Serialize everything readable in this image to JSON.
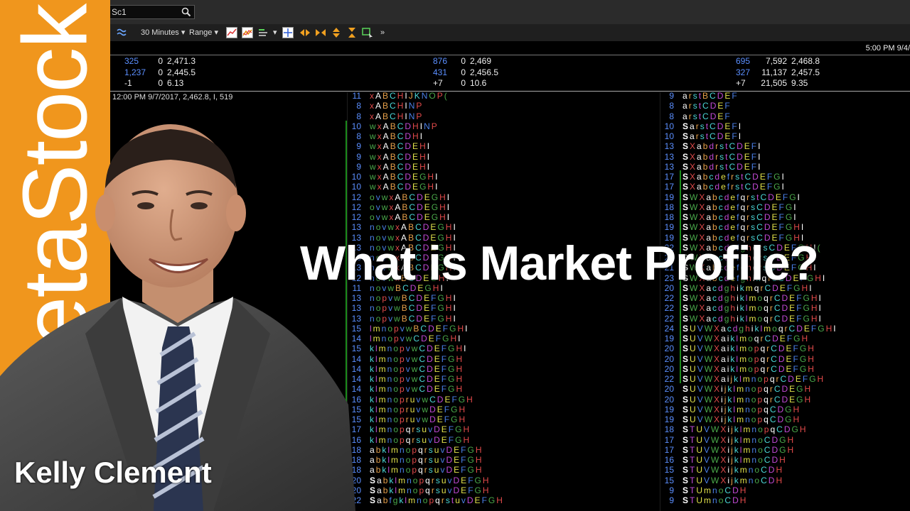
{
  "search": {
    "symbol": "Sc1"
  },
  "toolbar": {
    "interval": "30 Minutes",
    "range": "Range"
  },
  "status": {
    "datetime": "5:00 PM 9/4/"
  },
  "quotes": [
    {
      "rows": [
        [
          "325",
          "0",
          "2,471.3"
        ],
        [
          "1,237",
          "0",
          "2,445.5"
        ],
        [
          "-1",
          "0",
          "6.13"
        ]
      ]
    },
    {
      "rows": [
        [
          "876",
          "0",
          "2,469"
        ],
        [
          "431",
          "0",
          "2,456.5"
        ],
        [
          "+7",
          "0",
          "10.6"
        ]
      ]
    },
    {
      "rows": [
        [
          "695",
          "7,592",
          "2,468.8"
        ],
        [
          "327",
          "11,137",
          "2,457.5"
        ],
        [
          "+7",
          "21,505",
          "9.35"
        ]
      ]
    }
  ],
  "chart_info": "12:00 PM 9/7/2017, 2,462.8, I, 519",
  "profile_left": [
    [
      "11",
      "xABCHIJKNOP("
    ],
    [
      "8",
      "xABCHINP"
    ],
    [
      "8",
      "xABCHINP"
    ],
    [
      "10",
      "wxABCDHINP"
    ],
    [
      "8",
      "wxABCDHI"
    ],
    [
      "9",
      "wxABCDEHI"
    ],
    [
      "9",
      "wxABCDEHI"
    ],
    [
      "9",
      "wxABCDEHI"
    ],
    [
      "10",
      "wxABCDEGHI"
    ],
    [
      "10",
      "wxABCDEGHI"
    ],
    [
      "12",
      "ovwxABCDEGHI"
    ],
    [
      "12",
      "ovwxABCDEGHI"
    ],
    [
      "12",
      "ovwxABCDEGHI"
    ],
    [
      "13",
      "novwxABCDEGHI"
    ],
    [
      "13",
      "novwxABCDEGHI"
    ],
    [
      "13",
      "novwxABCDEGHI"
    ],
    [
      "13",
      "novwxABCDEGHI"
    ],
    [
      "13",
      "novwxABCDEGHI"
    ],
    [
      "12",
      "novwxBCDEGHI"
    ],
    [
      "11",
      "novwBCDEGHI"
    ],
    [
      "13",
      "nopvwBCDEFGHI"
    ],
    [
      "13",
      "nopvwBCDEFGHI"
    ],
    [
      "13",
      "nopvwBCDEFGHI"
    ],
    [
      "15",
      "lmnopvwBCDEFGHI"
    ],
    [
      "14",
      "lmnopvwCDEFGHI"
    ],
    [
      "15",
      "klmnopvwCDEFGHI"
    ],
    [
      "14",
      "klmnopvwCDEFGH"
    ],
    [
      "14",
      "klmnopvwCDEFGH"
    ],
    [
      "14",
      "klmnopvwCDEFGH"
    ],
    [
      "14",
      "klmnopvwCDEFGH"
    ],
    [
      "16",
      "klmnopruvwCDEFGH"
    ],
    [
      "15",
      "klmnopruvwDEFGH"
    ],
    [
      "15",
      "klmnopruvwDEFGH"
    ],
    [
      "17",
      "klmnopqrsuvDEFGH"
    ],
    [
      "16",
      "klmnopqrsuvDEFGH"
    ],
    [
      "18",
      "abklmnopqrsuvDEFGH"
    ],
    [
      "18",
      "abklmnopqrsuvDEFGH"
    ],
    [
      "18",
      "abklmnopqrsuvDEFGH"
    ],
    [
      "20",
      "SabklmnopqrsuvDEFGH"
    ],
    [
      "20",
      "SabklmnopqrsuvDEFGH"
    ],
    [
      "22",
      "SabfgklmnopqrstuvDEFGH"
    ]
  ],
  "profile_right": [
    [
      "9",
      "arstBCDEF"
    ],
    [
      "8",
      "arstCDEF"
    ],
    [
      "8",
      "arstCDEF"
    ],
    [
      "10",
      "SarstCDEFI"
    ],
    [
      "10",
      "SarstCDEFI"
    ],
    [
      "13",
      "SXabdrstCDEFI"
    ],
    [
      "13",
      "SXabdrstCDEFI"
    ],
    [
      "13",
      "SXabdrstCDEFI"
    ],
    [
      "17",
      "SXabcdefrstCDEFGI"
    ],
    [
      "17",
      "SXabcdefrstCDEFGI"
    ],
    [
      "19",
      "SWXabcdefqrstCDEFGI"
    ],
    [
      "18",
      "SWXabcdefqrsCDEFGI"
    ],
    [
      "18",
      "SWXabcdefqrsCDEFGI"
    ],
    [
      "19",
      "SWXabcdefqrsCDEFGHI"
    ],
    [
      "19",
      "SWXabcdefqrsCDEFGHI"
    ],
    [
      "22",
      "SWXabcdefghqrsCDEFGHI("
    ],
    [
      "21",
      "SWXabcdefghqrsCDEFGHI"
    ],
    [
      "21",
      "SWXabcdefghqrsCDEFGHI"
    ],
    [
      "23",
      "SWXabcdefghikqrsCDEFGHI"
    ],
    [
      "20",
      "SWXacdghikmqrCDEFGHI"
    ],
    [
      "22",
      "SWXacdghiklmoqrCDEFGHI"
    ],
    [
      "22",
      "SWXacdghiklmoqrCDEFGHI"
    ],
    [
      "22",
      "SWXacdghiklmoqrCDEFGHI"
    ],
    [
      "24",
      "SUVWXacdghiklmoqrCDEFGHI"
    ],
    [
      "19",
      "SUVWXaiklmoqrCDEFGH"
    ],
    [
      "20",
      "SUVWXaiklmopqrCDEFGH"
    ],
    [
      "20",
      "SUVWXaiklmopqrCDEFGH"
    ],
    [
      "20",
      "SUVWXaiklmopqrCDEFGH"
    ],
    [
      "22",
      "SUVWXaijklmnopqrCDEFGH"
    ],
    [
      "20",
      "SUVWXijklmnopqrCDEGH"
    ],
    [
      "20",
      "SUVWXijklmnopqrCDEGH"
    ],
    [
      "19",
      "SUVWXijklmnopqCDGH"
    ],
    [
      "19",
      "SUVWXijklmnopqCDGH"
    ],
    [
      "18",
      "STUVWXijklmnopqCDGH"
    ],
    [
      "17",
      "STUVWXijklmnoCDGH"
    ],
    [
      "17",
      "STUVWXijklmnoCDGH"
    ],
    [
      "16",
      "STUVWXijklmnoCDH"
    ],
    [
      "15",
      "STUVWXijkmnoCDH"
    ],
    [
      "15",
      "STUVWXijkmnoCDH"
    ],
    [
      "9",
      "STUmnoCDH"
    ],
    [
      "9",
      "STUmnoCDH"
    ]
  ],
  "brand": {
    "text": "MetaStock"
  },
  "headline": "What is Market Profile?",
  "presenter": "Kelly Clement",
  "colors": {
    "brand_orange": "#f0961d",
    "tpo_palette": [
      "#e04a4a",
      "#4aa84a",
      "#4a7fe6",
      "#e0e04a",
      "#c24ad6",
      "#4ad6d6",
      "#e6a04a",
      "#ffffff"
    ]
  }
}
